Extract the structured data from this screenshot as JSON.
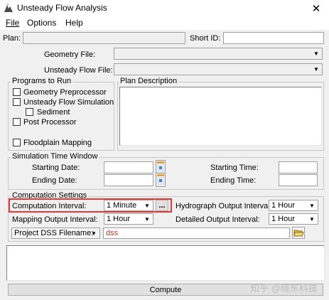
{
  "window": {
    "title": "Unsteady Flow Analysis",
    "close_glyph": "✕"
  },
  "menu": {
    "file": "File",
    "options": "Options",
    "help": "Help"
  },
  "plan": {
    "label": "Plan:",
    "value": "",
    "short_id_label": "Short ID:",
    "short_id_value": ""
  },
  "geometry_file": {
    "label": "Geometry File:",
    "value": ""
  },
  "unsteady_flow_file": {
    "label": "Unsteady Flow File:",
    "value": ""
  },
  "programs": {
    "legend": "Programs to Run",
    "geometry_preprocessor": "Geometry Preprocessor",
    "unsteady_flow_simulation": "Unsteady Flow Simulation",
    "sediment": "Sediment",
    "post_processor": "Post Processor",
    "floodplain_mapping": "Floodplain Mapping"
  },
  "plan_description": {
    "legend": "Plan Description",
    "value": ""
  },
  "time_window": {
    "legend": "Simulation Time Window",
    "starting_date": "Starting Date:",
    "ending_date": "Ending Date:",
    "starting_time": "Starting Time:",
    "ending_time": "Ending Time:"
  },
  "computation": {
    "legend": "Computation Settings",
    "interval_label": "Computation Interval:",
    "interval_value": "1 Minute",
    "more_button": "...",
    "hydrograph_label": "Hydrograph Output Interval:",
    "hydrograph_value": "1 Hour",
    "mapping_label": "Mapping Output Interval:",
    "mapping_value": "1 Hour",
    "detailed_label": "Detailed Output Interval:",
    "detailed_value": "1 Hour",
    "dss_selector": "Project DSS Filename:",
    "dss_value": "dss"
  },
  "compute_button": "Compute",
  "watermark": "知乎 @晓东科技",
  "colors": {
    "highlight": "#e53935",
    "dss_text": "#c0392b"
  },
  "icons": {
    "app": "app-icon",
    "close": "close-icon",
    "dropdown": "chevron-down-icon",
    "calendar": "calendar-icon",
    "folder": "open-folder-icon"
  }
}
